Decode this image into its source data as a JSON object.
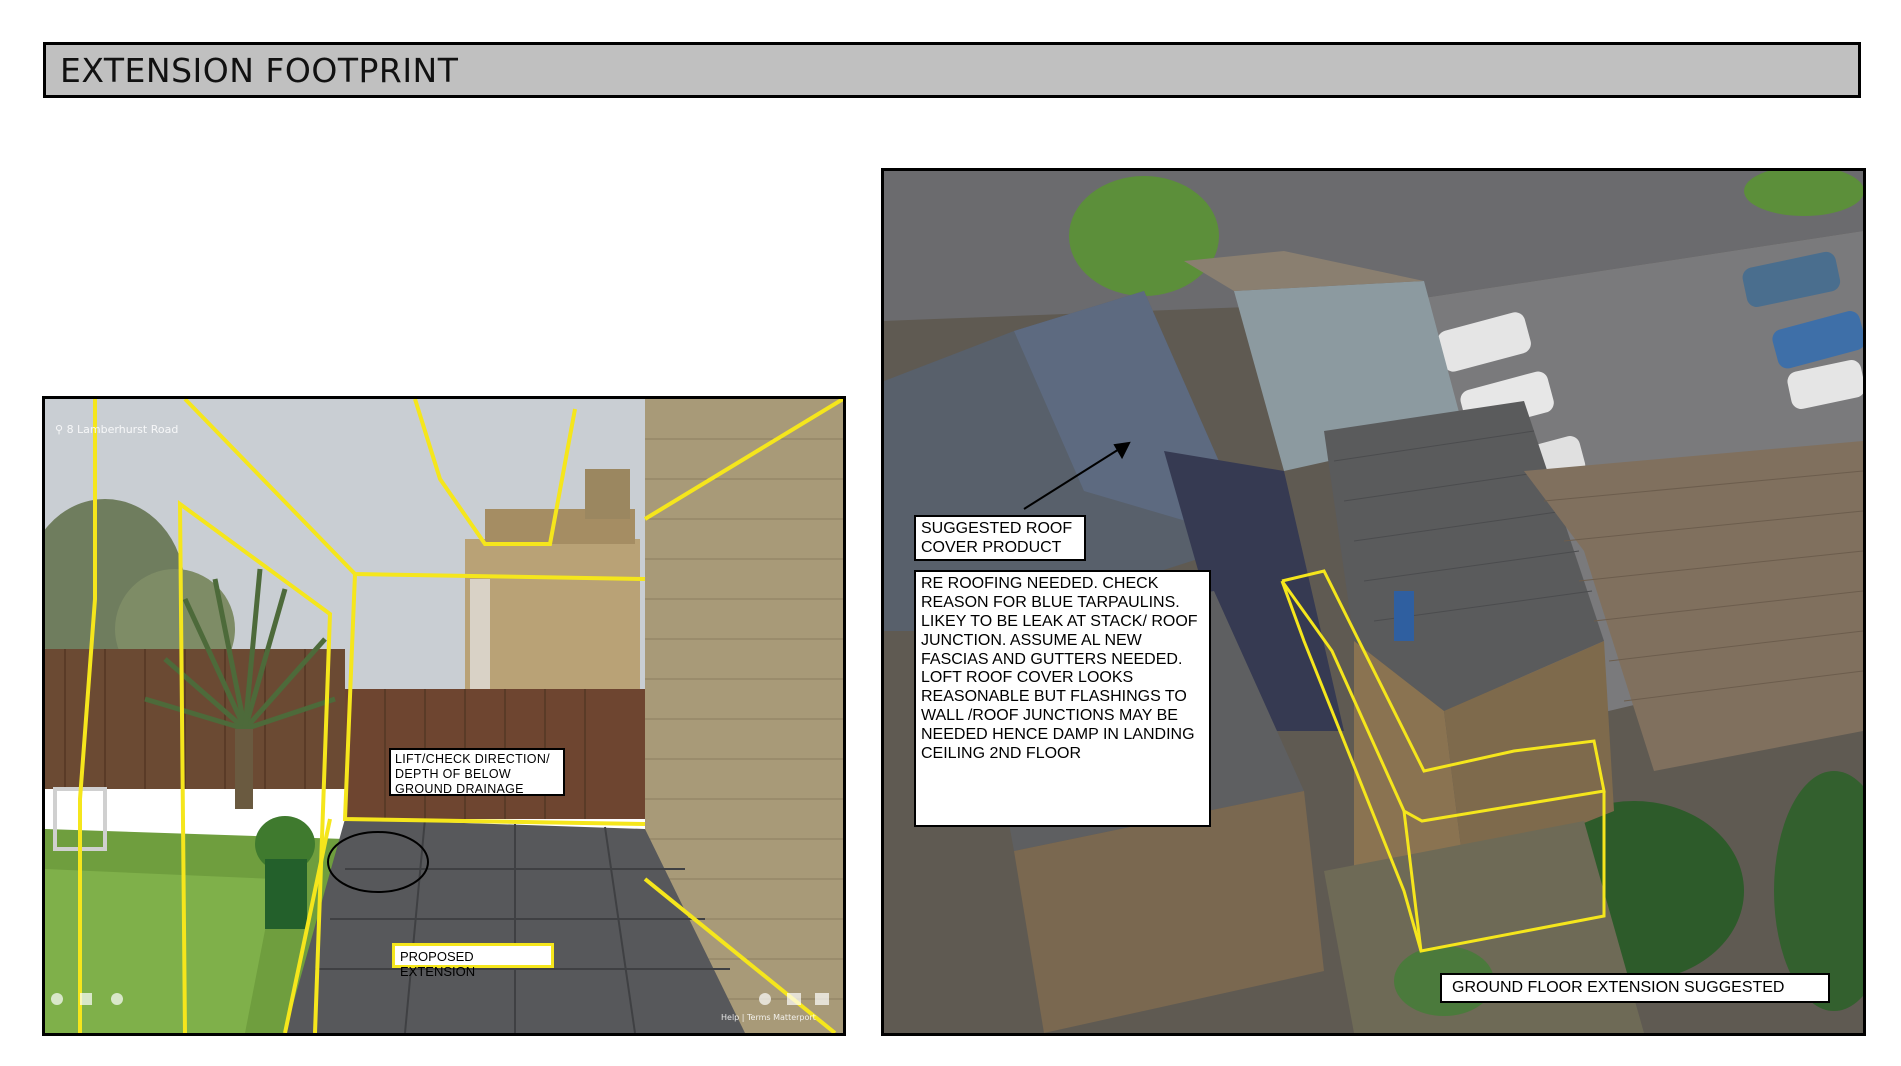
{
  "page": {
    "title": "EXTENSION FOOTPRINT"
  },
  "left_photo": {
    "location": "8 Lamberhurst Road",
    "footer": "Help  |  Terms   Matterport",
    "labels": {
      "drainage": "LIFT/CHECK DIRECTION/ DEPTH OF BELOW GROUND DRAINAGE",
      "proposed": "PROPOSED EXTENSION"
    }
  },
  "right_photo": {
    "labels": {
      "roof_cover": "SUGGESTED ROOF COVER PRODUCT",
      "notes": "RE ROOFING NEEDED. CHECK REASON FOR BLUE TARPAULINS. LIKEY TO BE LEAK AT STACK/ ROOF JUNCTION. ASSUME AL NEW FASCIAS AND GUTTERS NEEDED. LOFT ROOF COVER LOOKS REASONABLE BUT FLASHINGS TO WALL /ROOF JUNCTIONS MAY BE NEEDED HENCE DAMP IN LANDING CEILING 2ND FLOOR",
      "ground_floor": "GROUND FLOOR EXTENSION SUGGESTED"
    }
  },
  "colors": {
    "highlight": "#f5e61c",
    "title_bg": "#c0c0c0"
  }
}
